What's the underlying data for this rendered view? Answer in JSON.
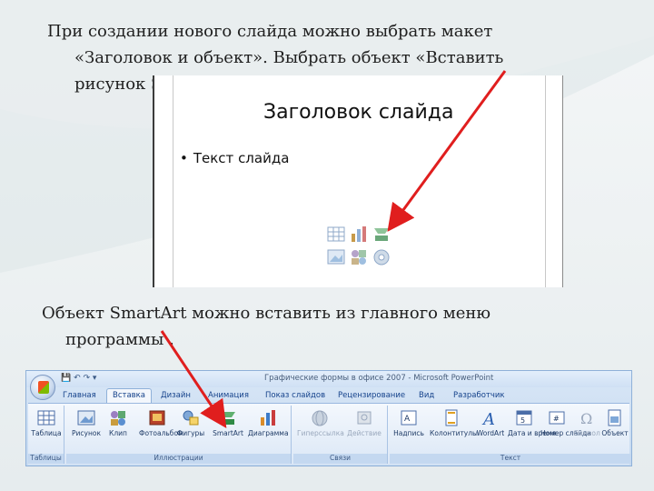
{
  "paragraph1": {
    "line1": "При создании нового слайда можно выбрать макет",
    "line2": "«Заголовок и объект». Выбрать объект «Вставить",
    "line3": "рисунок SmartArt»"
  },
  "slide": {
    "title": "Заголовок слайда",
    "bullet": "Текст слайда",
    "icons": [
      "table-icon",
      "chart-icon",
      "smartart-icon",
      "picture-icon",
      "clipart-icon",
      "media-icon"
    ]
  },
  "paragraph2": {
    "line1": "Объект SmartArt можно вставить из главного меню",
    "line2": "программы ."
  },
  "ribbon": {
    "window_title": "Графические формы в офисе 2007 - Microsoft PowerPoint",
    "tabs": [
      "Главная",
      "Вставка",
      "Дизайн",
      "Анимация",
      "Показ слайдов",
      "Рецензирование",
      "Вид",
      "Разработчик"
    ],
    "active_tab": "Вставка",
    "groups": {
      "tables": {
        "label": "Таблицы",
        "buttons": [
          "Таблица"
        ]
      },
      "illustrations": {
        "label": "Иллюстрации",
        "buttons": [
          "Рисунок",
          "Клип",
          "Фотоальбом",
          "Фигуры",
          "SmartArt",
          "Диаграмма"
        ]
      },
      "links": {
        "label": "Связи",
        "buttons": [
          "Гиперссылка",
          "Действие"
        ]
      },
      "text": {
        "label": "Текст",
        "buttons": [
          "Надпись",
          "Колонтитулы",
          "WordArt",
          "Дата и время",
          "Номер слайда",
          "Символ",
          "Объект"
        ]
      }
    }
  },
  "colors": {
    "arrow": "#e01e1e",
    "text": "#1f1f1f",
    "ribbon_label": "#1e3a66"
  }
}
